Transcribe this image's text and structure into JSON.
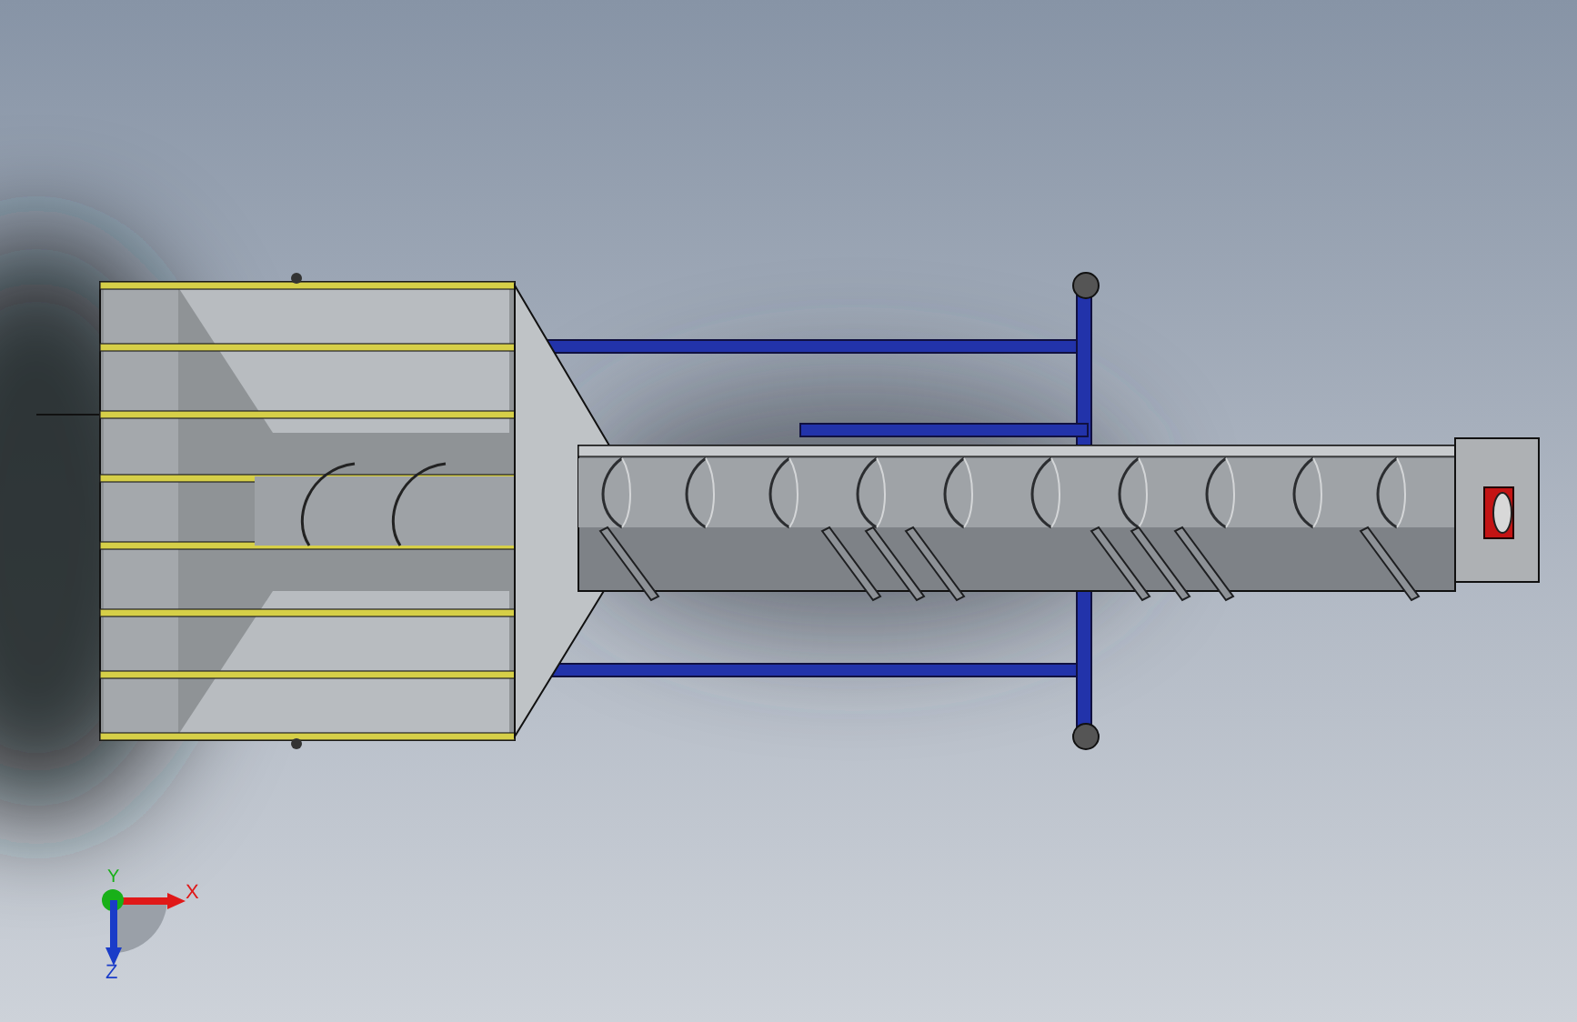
{
  "triad": {
    "axes": [
      {
        "kind": "horizontal",
        "label": "X",
        "color": "#e01818"
      },
      {
        "kind": "dot",
        "label": "Y",
        "color": "#18b018"
      },
      {
        "kind": "vertical",
        "label": "Z",
        "color": "#1a3cc8"
      }
    ]
  }
}
